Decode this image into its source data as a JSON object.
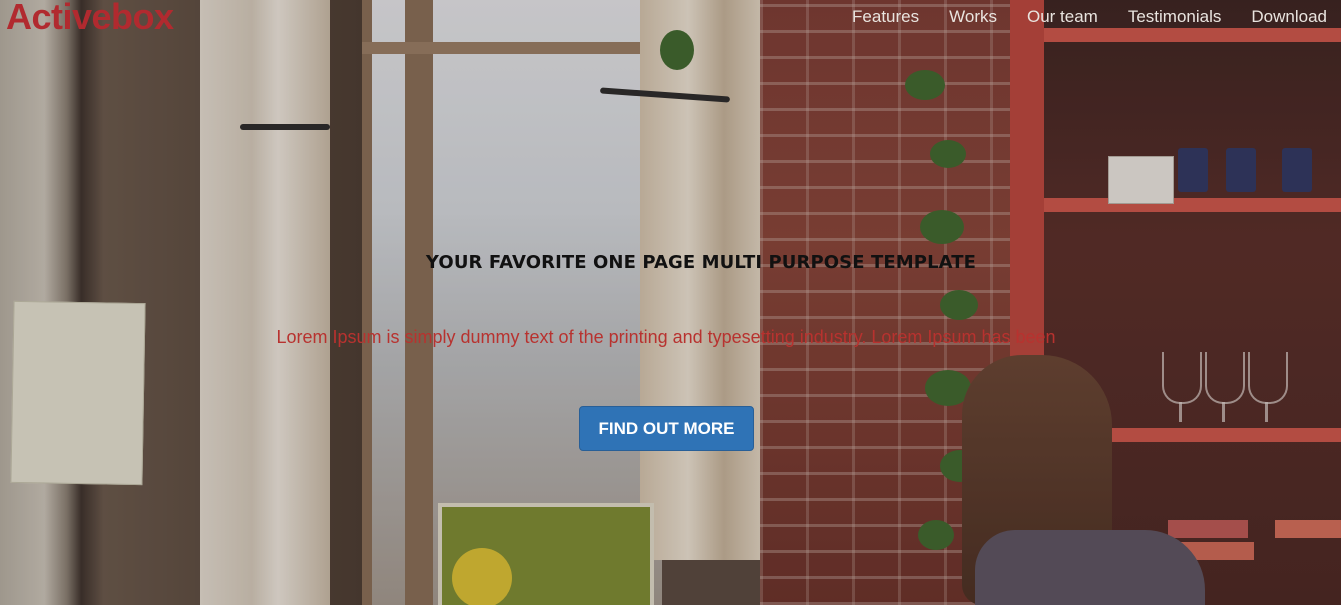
{
  "brand": {
    "name": "Activebox"
  },
  "nav": {
    "items": [
      {
        "label": "Features"
      },
      {
        "label": "Works"
      },
      {
        "label": "Our team"
      },
      {
        "label": "Testimonials"
      },
      {
        "label": "Download"
      }
    ]
  },
  "hero": {
    "headline": "YOUR FAVORITE ONE PAGE MULTI PURPOSE TEMPLATE",
    "lead": "Lorem Ipsum is simply dummy text of the printing and typesetting industry. Lorem Ipsum has been",
    "cta_label": "FIND OUT MORE"
  },
  "colors": {
    "brand": "#b12a2f",
    "lead_text": "#b8322f",
    "cta_background": "#2f73b6",
    "nav_text": "#e9e4df"
  }
}
